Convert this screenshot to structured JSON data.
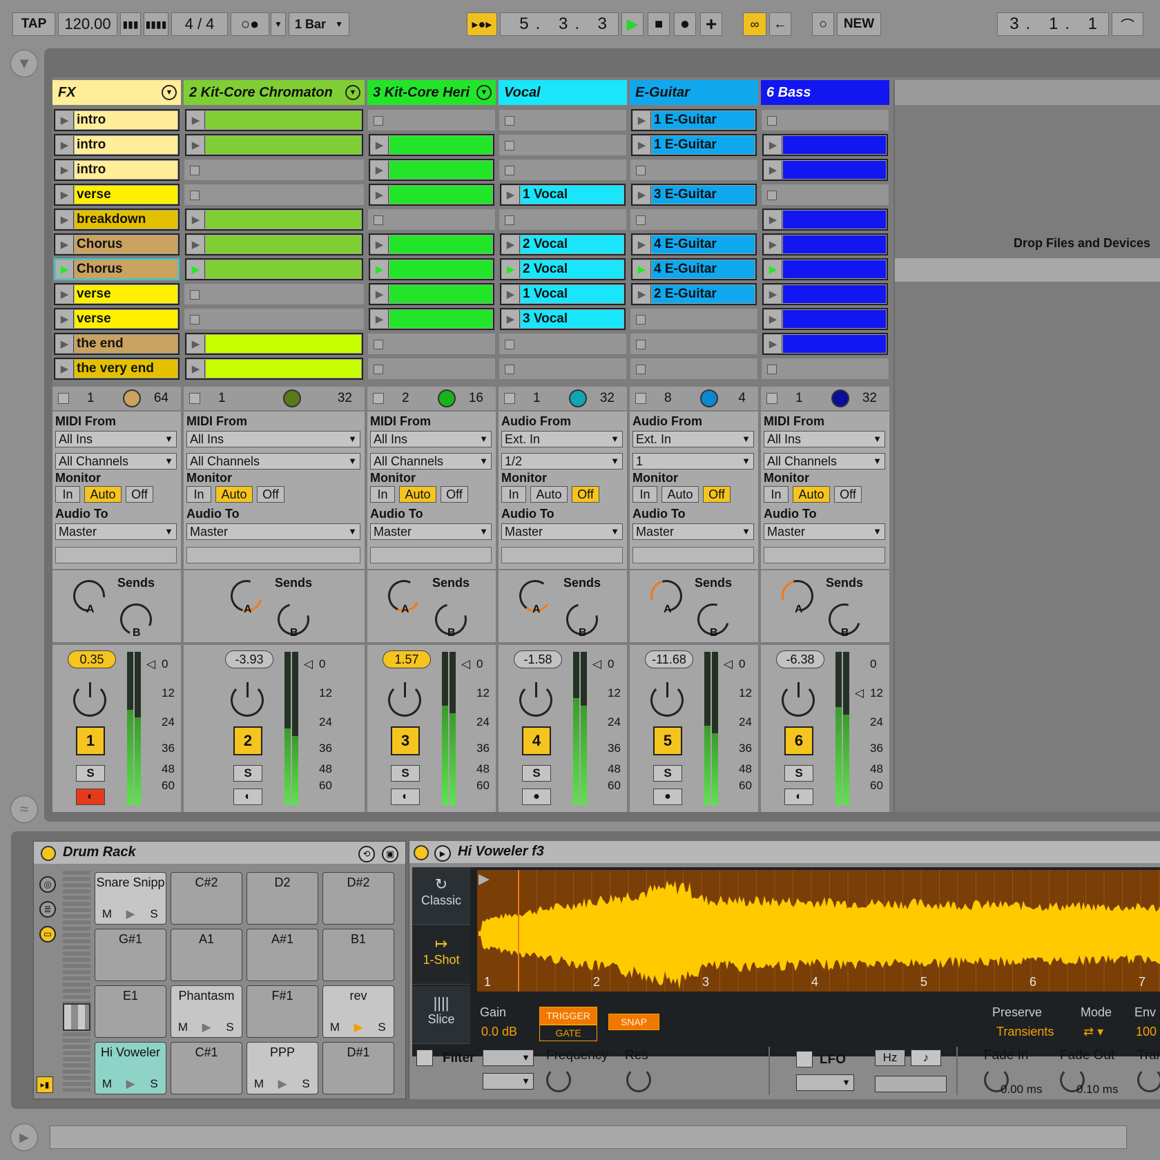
{
  "transport": {
    "tap": "TAP",
    "tempo": "120.00",
    "signature": "4  /  4",
    "metronome": "○●",
    "quantize": "1 Bar",
    "arrangement_position": "5.  3.  3",
    "new_label": "NEW",
    "loop_position": "3.  1.  1"
  },
  "tracks": [
    {
      "name": "FX",
      "color": "#ffed9a",
      "clips": [
        "intro",
        "intro",
        "intro",
        "verse",
        "breakdown",
        "Chorus",
        "Chorus",
        "verse",
        "verse",
        "the end",
        "the very end"
      ],
      "clip_colors": [
        "#ffed9a",
        "#ffed9a",
        "#ffed9a",
        "#fff000",
        "#e3c100",
        "#c9a35f",
        "#c9a35f",
        "#fff000",
        "#fff000",
        "#c9a35f",
        "#e3c100"
      ],
      "status_left": "1",
      "status_right": "64",
      "knob_color": "#c9a35f",
      "input_label": "MIDI From",
      "input_type": "All Ins",
      "input_channel": "All Channels",
      "monitor": "Auto",
      "output": "Master",
      "volume": "0.35",
      "volume_highlight": true,
      "number": "1",
      "arm_on": true
    },
    {
      "name": "2 Kit-Core Chromaton",
      "color": "#7fcf34",
      "clips": [
        "",
        "",
        null,
        null,
        "",
        "",
        "",
        null,
        null,
        "",
        ""
      ],
      "clip_colors": [
        "#7fcf34",
        "#7fcf34",
        null,
        null,
        "#7fcf34",
        "#7fcf34",
        "#7fcf34",
        null,
        null,
        "#c8ff00",
        "#c8ff00"
      ],
      "status_left": "1",
      "status_right": "32",
      "knob_color": "#5a7a19",
      "input_label": "MIDI From",
      "input_type": "All Ins",
      "input_channel": "All Channels",
      "monitor": "Auto",
      "output": "Master",
      "volume": "-3.93",
      "volume_highlight": false,
      "number": "2",
      "arm_on": false
    },
    {
      "name": "3 Kit-Core Heri",
      "color": "#22e52a",
      "clips": [
        null,
        "",
        "",
        "",
        null,
        "",
        "",
        "",
        "",
        null,
        null
      ],
      "clip_colors": [
        null,
        "#22e52a",
        "#22e52a",
        "#22e52a",
        null,
        "#22e52a",
        "#22e52a",
        "#22e52a",
        "#22e52a",
        null,
        null
      ],
      "status_left": "2",
      "status_right": "16",
      "knob_color": "#17b41d",
      "input_label": "MIDI From",
      "input_type": "All Ins",
      "input_channel": "All Channels",
      "monitor": "Auto",
      "output": "Master",
      "volume": "1.57",
      "volume_highlight": true,
      "number": "3",
      "arm_on": false
    },
    {
      "name": "Vocal",
      "color": "#19e6fb",
      "clips": [
        null,
        null,
        null,
        "1 Vocal",
        null,
        "2 Vocal",
        "2 Vocal",
        "1 Vocal",
        "3 Vocal",
        null,
        null
      ],
      "clip_colors": [
        null,
        null,
        null,
        "#19e6fb",
        null,
        "#19e6fb",
        "#19e6fb",
        "#19e6fb",
        "#19e6fb",
        null,
        null
      ],
      "status_left": "1",
      "status_right": "32",
      "knob_color": "#10a5b5",
      "input_label": "Audio From",
      "input_type": "Ext. In",
      "input_channel": "1/2",
      "monitor": "Off",
      "output": "Master",
      "volume": "-1.58",
      "volume_highlight": false,
      "number": "4",
      "arm_on": false
    },
    {
      "name": "E-Guitar",
      "color": "#0fa8ee",
      "clips": [
        "1 E-Guitar",
        "1 E-Guitar",
        null,
        "3 E-Guitar",
        null,
        "4 E-Guitar",
        "4 E-Guitar",
        "2 E-Guitar",
        null,
        null,
        null
      ],
      "clip_colors": [
        "#0fa8ee",
        "#0fa8ee",
        null,
        "#0fa8ee",
        null,
        "#0fa8ee",
        "#0fa8ee",
        "#0fa8ee",
        null,
        null,
        null
      ],
      "status_left": "8",
      "status_right": "4",
      "knob_color": "#0b88d0",
      "input_label": "Audio From",
      "input_type": "Ext. In",
      "input_channel": "1",
      "monitor": "Off",
      "output": "Master",
      "volume": "-11.68",
      "volume_highlight": false,
      "number": "5",
      "arm_on": false
    },
    {
      "name": "6 Bass",
      "color": "#1216f0",
      "clips": [
        null,
        "",
        "",
        null,
        "",
        "",
        "",
        "",
        "",
        "",
        null
      ],
      "clip_colors": [
        null,
        "#1216f0",
        "#1216f0",
        null,
        "#1216f0",
        "#1216f0",
        "#1216f0",
        "#1216f0",
        "#1216f0",
        "#1216f0",
        null
      ],
      "status_left": "1",
      "status_right": "32",
      "knob_color": "#0a0e9a",
      "input_label": "MIDI From",
      "input_type": "All Ins",
      "input_channel": "All Channels",
      "monitor": "Auto",
      "output": "Master",
      "volume": "-6.38",
      "volume_highlight": false,
      "number": "6",
      "arm_on": false
    }
  ],
  "labels": {
    "monitor": "Monitor",
    "audio_to": "Audio To",
    "sends": "Sends",
    "send_a": "A",
    "send_b": "B",
    "mon_in": "In",
    "mon_auto": "Auto",
    "mon_off": "Off",
    "solo": "S",
    "drop_hint": "Drop Files and Devices",
    "meter_scale": [
      "0",
      "12",
      "24",
      "36",
      "48",
      "60"
    ]
  },
  "drum_rack": {
    "title": "Drum Rack",
    "pads": [
      {
        "name": "Snare Snipp",
        "filled": true
      },
      {
        "name": "C#2"
      },
      {
        "name": "D2"
      },
      {
        "name": "D#2"
      },
      {
        "name": "G#1"
      },
      {
        "name": "A1"
      },
      {
        "name": "A#1"
      },
      {
        "name": "B1"
      },
      {
        "name": "E1"
      },
      {
        "name": "Phantasm",
        "filled": true
      },
      {
        "name": "F#1"
      },
      {
        "name": "rev",
        "filled": true,
        "playing": true
      },
      {
        "name": "Hi Voweler",
        "filled": true,
        "selected": true
      },
      {
        "name": "C#1"
      },
      {
        "name": "PPP",
        "filled": true
      },
      {
        "name": "D#1"
      }
    ],
    "pad_mute": "M",
    "pad_solo": "S"
  },
  "simpler": {
    "title": "Hi Voweler f3",
    "modes": [
      "Classic",
      "1-Shot",
      "Slice"
    ],
    "active_mode": "1-Shot",
    "ruler": [
      "1",
      "2",
      "3",
      "4",
      "5",
      "6",
      "7"
    ],
    "gain_label": "Gain",
    "gain_value": "0.0 dB",
    "trigger": "TRIGGER",
    "gate": "GATE",
    "snap": "SNAP",
    "preserve_label": "Preserve",
    "preserve_value": "Transients",
    "mode_label": "Mode",
    "env_label": "Env",
    "env_value": "100",
    "filter": "Filter",
    "frequency": "Frequency",
    "res": "Res",
    "lfo": "LFO",
    "hz": "Hz",
    "note": "♪",
    "fade_in_label": "Fade In",
    "fade_in_value": "0.00 ms",
    "fade_out_label": "Fade Out",
    "fade_out_value": "0.10 ms",
    "tran_label": "Tran"
  }
}
